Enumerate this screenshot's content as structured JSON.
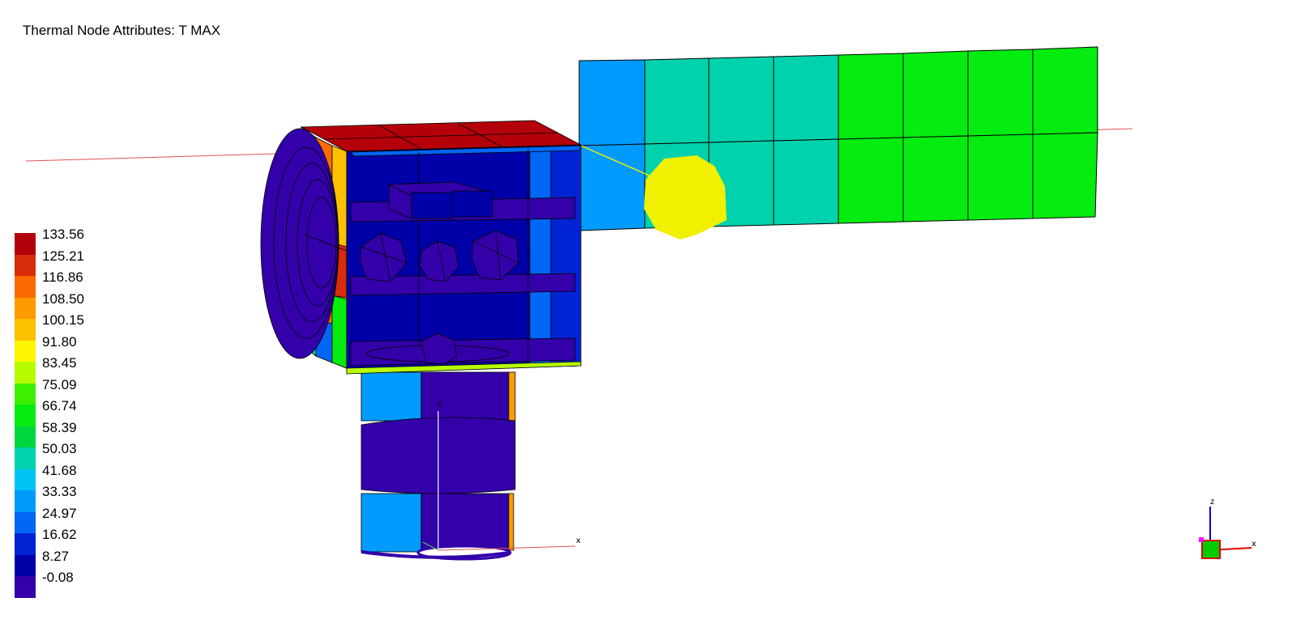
{
  "view": {
    "title": "Thermal Node Attributes: T MAX"
  },
  "legend": {
    "items": [
      {
        "label": "133.56",
        "color": "#b4000a"
      },
      {
        "label": "125.21",
        "color": "#d82c0a"
      },
      {
        "label": "116.86",
        "color": "#fb6a00"
      },
      {
        "label": "108.50",
        "color": "#fd9b00"
      },
      {
        "label": "100.15",
        "color": "#fdc100"
      },
      {
        "label": "91.80",
        "color": "#fdf600"
      },
      {
        "label": "83.45",
        "color": "#b7fd00"
      },
      {
        "label": "75.09",
        "color": "#3cf000"
      },
      {
        "label": "66.74",
        "color": "#04ec10"
      },
      {
        "label": "58.39",
        "color": "#00d63e"
      },
      {
        "label": "50.03",
        "color": "#00d2ad"
      },
      {
        "label": "41.68",
        "color": "#00c3f5"
      },
      {
        "label": "33.33",
        "color": "#009bfd"
      },
      {
        "label": "24.97",
        "color": "#0066f5"
      },
      {
        "label": "16.62",
        "color": "#0024d4"
      },
      {
        "label": "8.27",
        "color": "#0000a8"
      },
      {
        "label": "-0.08",
        "color": "#3300aa"
      }
    ]
  },
  "axes": {
    "model_x_label": "x",
    "model_z_label": "z",
    "triad_x_label": "x",
    "triad_z_label": "z"
  }
}
